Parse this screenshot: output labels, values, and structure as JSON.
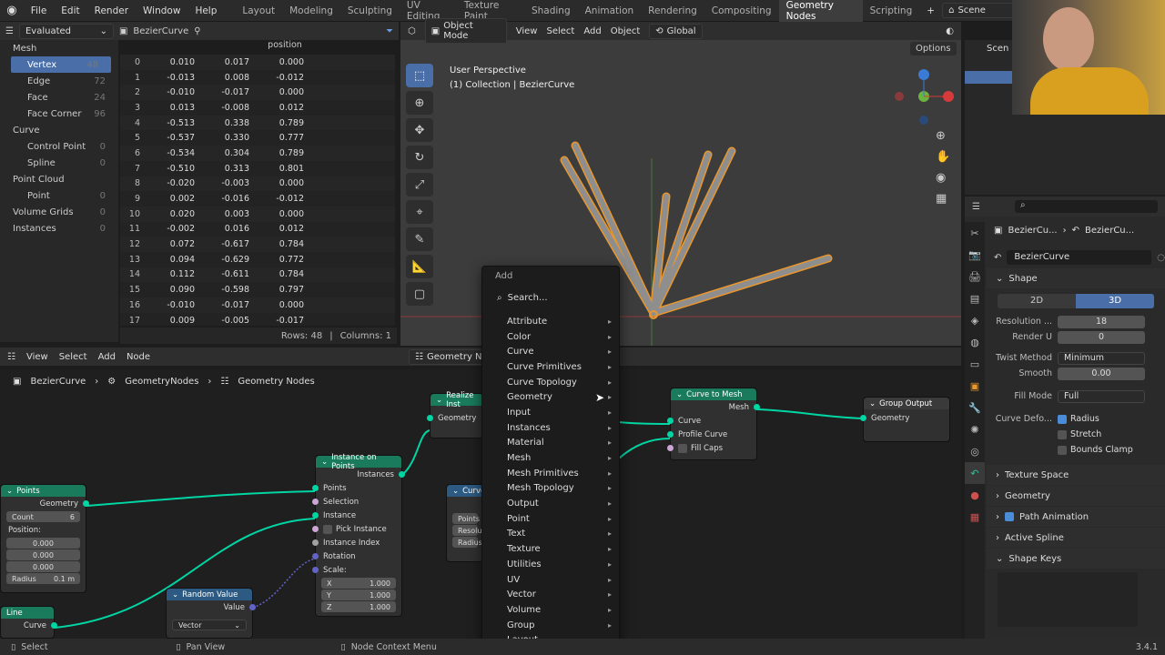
{
  "topbar": {
    "menus": [
      "File",
      "Edit",
      "Render",
      "Window",
      "Help"
    ],
    "workspaces": [
      "Layout",
      "Modeling",
      "Sculpting",
      "UV Editing",
      "Texture Paint",
      "Shading",
      "Animation",
      "Rendering",
      "Compositing",
      "Geometry Nodes",
      "Scripting"
    ],
    "active_workspace": "Geometry Nodes",
    "scene": "Scene"
  },
  "spreadsheet": {
    "mode": "Evaluated",
    "object": "BezierCurve",
    "column_header": "position",
    "domains": [
      {
        "label": "Mesh",
        "count": "",
        "level": 0
      },
      {
        "label": "Vertex",
        "count": "48",
        "level": 1,
        "selected": true
      },
      {
        "label": "Edge",
        "count": "72",
        "level": 1
      },
      {
        "label": "Face",
        "count": "24",
        "level": 1
      },
      {
        "label": "Face Corner",
        "count": "96",
        "level": 1
      },
      {
        "label": "Curve",
        "count": "",
        "level": 0
      },
      {
        "label": "Control Point",
        "count": "0",
        "level": 1
      },
      {
        "label": "Spline",
        "count": "0",
        "level": 1
      },
      {
        "label": "Point Cloud",
        "count": "",
        "level": 0
      },
      {
        "label": "Point",
        "count": "0",
        "level": 1
      },
      {
        "label": "Volume Grids",
        "count": "0",
        "level": 0
      },
      {
        "label": "Instances",
        "count": "0",
        "level": 0
      }
    ],
    "rows": [
      [
        "0",
        "0.010",
        "0.017",
        "0.000"
      ],
      [
        "1",
        "-0.013",
        "0.008",
        "-0.012"
      ],
      [
        "2",
        "-0.010",
        "-0.017",
        "0.000"
      ],
      [
        "3",
        "0.013",
        "-0.008",
        "0.012"
      ],
      [
        "4",
        "-0.513",
        "0.338",
        "0.789"
      ],
      [
        "5",
        "-0.537",
        "0.330",
        "0.777"
      ],
      [
        "6",
        "-0.534",
        "0.304",
        "0.789"
      ],
      [
        "7",
        "-0.510",
        "0.313",
        "0.801"
      ],
      [
        "8",
        "-0.020",
        "-0.003",
        "0.000"
      ],
      [
        "9",
        "0.002",
        "-0.016",
        "-0.012"
      ],
      [
        "10",
        "0.020",
        "0.003",
        "0.000"
      ],
      [
        "11",
        "-0.002",
        "0.016",
        "0.012"
      ],
      [
        "12",
        "0.072",
        "-0.617",
        "0.784"
      ],
      [
        "13",
        "0.094",
        "-0.629",
        "0.772"
      ],
      [
        "14",
        "0.112",
        "-0.611",
        "0.784"
      ],
      [
        "15",
        "0.090",
        "-0.598",
        "0.797"
      ],
      [
        "16",
        "-0.010",
        "-0.017",
        "0.000"
      ],
      [
        "17",
        "0.009",
        "-0.005",
        "-0.017"
      ]
    ],
    "rows_label": "Rows: 48",
    "cols_label": "Columns: 1"
  },
  "viewport": {
    "mode": "Object Mode",
    "menus": [
      "View",
      "Select",
      "Add",
      "Object"
    ],
    "transform": "Global",
    "options": "Options",
    "title": "User Perspective",
    "subtitle": "(1) Collection | BezierCurve"
  },
  "node_editor": {
    "menus": [
      "View",
      "Select",
      "Add",
      "Node"
    ],
    "tree_name": "Geometry Nodes",
    "breadcrumb": [
      "BezierCurve",
      "GeometryNodes",
      "Geometry Nodes"
    ],
    "nodes": {
      "points": {
        "title": "Points",
        "out": "Geometry",
        "count_label": "Count",
        "count": "6",
        "position_label": "Position:",
        "pos": [
          "0.000",
          "0.000",
          "0.000"
        ],
        "radius_label": "Radius",
        "radius": "0.1 m"
      },
      "instance_on_points": {
        "title": "Instance on Points",
        "out": "Instances",
        "inputs": [
          "Points",
          "Selection",
          "Instance",
          "Pick Instance",
          "Instance Index",
          "Rotation",
          "Scale:"
        ],
        "scale": [
          [
            "X",
            "1.000"
          ],
          [
            "Y",
            "1.000"
          ],
          [
            "Z",
            "1.000"
          ]
        ]
      },
      "realize": {
        "title": "Realize Inst",
        "in": "Geometry"
      },
      "curve_small": {
        "title": "Curve",
        "rows": [
          "Points",
          "Resolu",
          "Radius"
        ]
      },
      "curve_to_mesh": {
        "title": "Curve to Mesh",
        "out": "Mesh",
        "inputs": [
          "Curve",
          "Profile Curve",
          "Fill Caps"
        ]
      },
      "group_output": {
        "title": "Group Output",
        "in": "Geometry"
      },
      "random_value": {
        "title": "Random Value",
        "out": "Value",
        "type": "Vector"
      },
      "line": {
        "title": "Line",
        "out": "Curve"
      }
    }
  },
  "add_menu": {
    "title": "Add",
    "search": "Search...",
    "items": [
      "Attribute",
      "Color",
      "Curve",
      "Curve Primitives",
      "Curve Topology",
      "Geometry",
      "Input",
      "Instances",
      "Material",
      "Mesh",
      "Mesh Primitives",
      "Mesh Topology",
      "Output",
      "Point",
      "Text",
      "Texture",
      "Utilities",
      "UV",
      "Vector",
      "Volume",
      "Group",
      "Layout"
    ]
  },
  "properties": {
    "breadcrumb_a": "BezierCu...",
    "breadcrumb_b": "BezierCu...",
    "data_name": "BezierCurve",
    "shape_label": "Shape",
    "dim_2d": "2D",
    "dim_3d": "3D",
    "resolution_label": "Resolution ...",
    "resolution": "18",
    "render_u_label": "Render U",
    "render_u": "0",
    "twist_label": "Twist Method",
    "twist": "Minimum",
    "smooth_label": "Smooth",
    "smooth": "0.00",
    "fill_label": "Fill Mode",
    "fill": "Full",
    "deform_label": "Curve Defo...",
    "radius_chk": "Radius",
    "stretch_chk": "Stretch",
    "bounds_chk": "Bounds Clamp",
    "sections": [
      "Texture Space",
      "Geometry",
      "Path Animation",
      "Active Spline",
      "Shape Keys"
    ]
  },
  "outliner": {
    "scene_label": "Scen"
  },
  "status": {
    "select": "Select",
    "pan": "Pan View",
    "ctx": "Node Context Menu",
    "version": "3.4.1"
  }
}
